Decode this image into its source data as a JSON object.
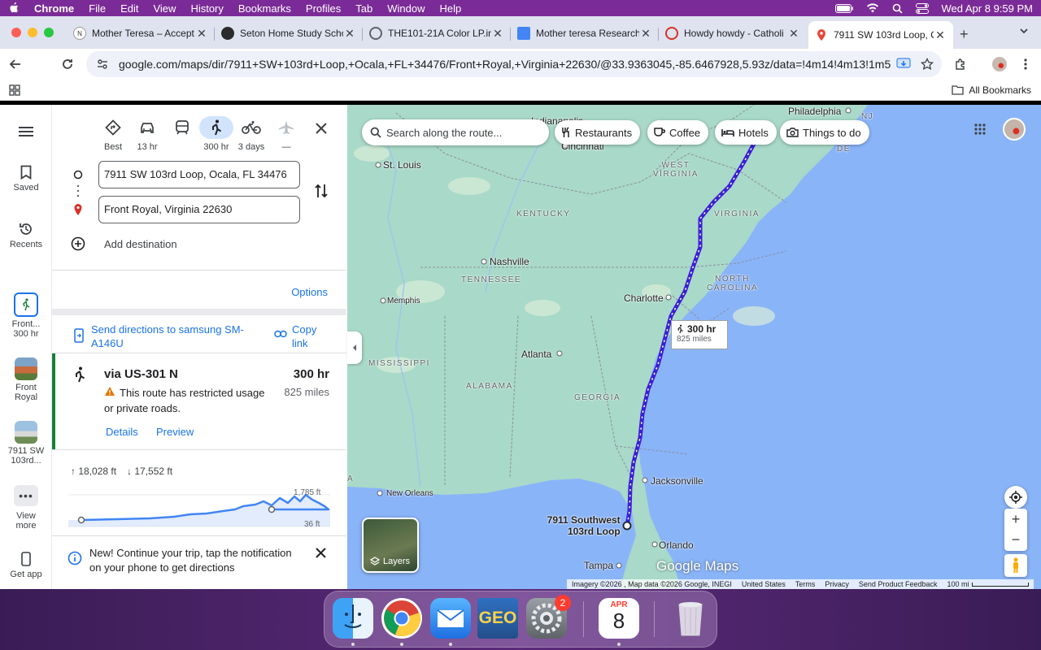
{
  "menubar": {
    "app": "Chrome",
    "items": [
      "File",
      "Edit",
      "View",
      "History",
      "Bookmarks",
      "Profiles",
      "Tab",
      "Window",
      "Help"
    ],
    "datetime": "Wed Apr 8  9:59 PM"
  },
  "tabs": [
    {
      "title": "Mother Teresa – Accept"
    },
    {
      "title": "Seton Home Study Scho"
    },
    {
      "title": "THE101-21A Color LP.in"
    },
    {
      "title": "Mother teresa Research"
    },
    {
      "title": "Howdy howdy - Catholi"
    },
    {
      "title": "7911 SW 103rd Loop, O"
    }
  ],
  "toolbar": {
    "url": "google.com/maps/dir/7911+SW+103rd+Loop,+Ocala,+FL+34476/Front+Royal,+Virginia+22630/@33.9363045,-85.6467928,5.93z/data=!4m14!4m13!1m5!1m1!1...",
    "all_bookmarks": "All Bookmarks"
  },
  "rail": {
    "saved": "Saved",
    "recents": "Recents",
    "recent1_line1": "Front...",
    "recent1_line2": "300 hr",
    "recent2_line1": "Front",
    "recent2_line2": "Royal",
    "recent3_line1": "7911 SW",
    "recent3_line2": "103rd...",
    "view_more_line1": "View",
    "view_more_line2": "more",
    "get_app": "Get app"
  },
  "modes": [
    {
      "label": "Best"
    },
    {
      "label": "13 hr"
    },
    {
      "label": ""
    },
    {
      "label": "300 hr"
    },
    {
      "label": "3 days"
    },
    {
      "label": "—"
    }
  ],
  "directions": {
    "origin": "7911 SW 103rd Loop, Ocala, FL 34476",
    "destination": "Front Royal, Virginia 22630",
    "add_destination": "Add destination",
    "options": "Options",
    "send_line1": "Send directions to samsung SM-",
    "send_line2": "A146U",
    "copy_line1": "Copy",
    "copy_line2": "link"
  },
  "route": {
    "via": "via US-301 N",
    "duration": "300 hr",
    "distance": "825 miles",
    "warning_line1": "This route has restricted usage",
    "warning_line2": "or private roads.",
    "details": "Details",
    "preview": "Preview"
  },
  "elevation": {
    "up": "18,028 ft",
    "down": "17,552 ft",
    "max_label": "1,785 ft",
    "min_label": "36 ft"
  },
  "notice": {
    "line1": "New! Continue your trip, tap the notification",
    "line2": "on your phone to get directions"
  },
  "map": {
    "search_placeholder": "Search along the route...",
    "chips": [
      "Restaurants",
      "Coffee",
      "Hotels",
      "Things to do"
    ],
    "cities": {
      "indianapolis": "Indianapolis",
      "cincinnati": "Cincinnati",
      "philadelphia": "Philadelphia",
      "stlouis": "St. Louis",
      "nashville": "Nashville",
      "memphis": "Memphis",
      "charlotte": "Charlotte",
      "atlanta": "Atlanta",
      "jacksonville": "Jacksonville",
      "orlando": "Orlando",
      "tampa": "Tampa",
      "neworleans": "New Orleans",
      "origin_line1": "7911 Southwest",
      "origin_line2": "103rd Loop"
    },
    "states": {
      "wv_line1": "WEST",
      "wv_line2": "VIRGINIA",
      "kentucky": "KENTUCKY",
      "virginia": "VIRGINIA",
      "tennessee": "TENNESSEE",
      "nc_line1": "NORTH",
      "nc_line2": "CAROLINA",
      "mississippi": "MISSISSIPPI",
      "alabama": "ALABAMA",
      "georgia": "GEORGIA",
      "de": "DE",
      "nj": "NJ",
      "a": "A"
    },
    "route_box_duration": "300 hr",
    "route_box_distance": "825 miles",
    "layers": "Layers",
    "logo": "Google Maps",
    "attribution": [
      "Imagery ©2026 , Map data ©2026 Google, INEGI",
      "United States",
      "Terms",
      "Privacy",
      "Send Product Feedback",
      "100 mi"
    ]
  },
  "dock": {
    "mail_badge": "2",
    "cal_month": "APR",
    "cal_day": "8",
    "geo_label": "GEO"
  },
  "colors": {
    "accent": "#1a73e8",
    "route": "#3b1fd6",
    "map_land": "#a9d9c8",
    "map_water": "#8ab4f8"
  }
}
